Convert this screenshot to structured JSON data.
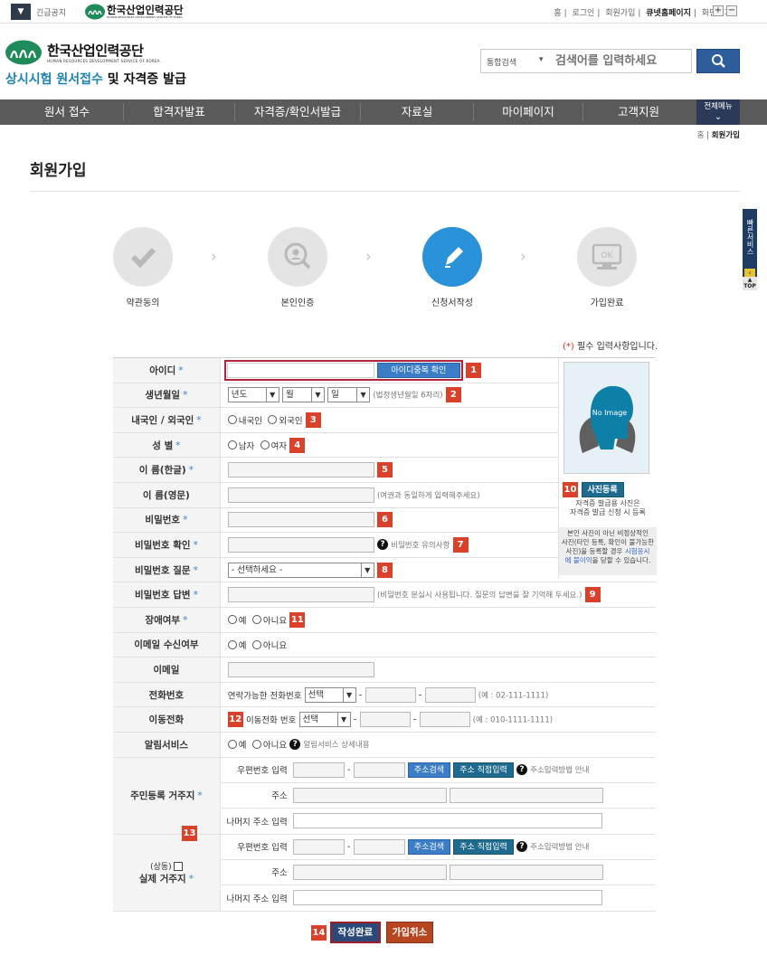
{
  "topbar": {
    "urgent": "긴급공지",
    "logo_ko": "한국산업인력공단",
    "logo_en": "HUMAN RESOURCES DEVELOPMENT SERVICE OF KOREA",
    "links": [
      "홈",
      "로그인",
      "회원가입",
      "큐넷홈페이지",
      "화면크기"
    ],
    "zoom_in": "+",
    "zoom_out": "−"
  },
  "header": {
    "logo_ko": "한국산업인력공단",
    "logo_en": "HUMAN RESOURCES DEVELOPMENT SERVICE OF KOREA",
    "subtitle_hl": "상시시험 원서접수",
    "subtitle_rest": " 및 자격증 발급",
    "search_scope": "통합검색",
    "search_placeholder": "검색어를 입력하세요"
  },
  "gnb": {
    "items": [
      "원서 접수",
      "합격자발표",
      "자격증/확인서발급",
      "자료실",
      "마이페이지",
      "고객지원"
    ],
    "all_menu": "전체메뉴"
  },
  "breadcrumb": {
    "home": "홈",
    "current": "회원가입"
  },
  "page_title": "회원가입",
  "quick": {
    "label": "빠른서비스",
    "top": "TOP"
  },
  "steps": [
    {
      "label": "약관동의",
      "state": "done"
    },
    {
      "label": "본인인증",
      "state": "done"
    },
    {
      "label": "신청서작성",
      "state": "active"
    },
    {
      "label": "가입완료",
      "state": "todo"
    }
  ],
  "required_note": {
    "mark": "(*)",
    "text": " 필수 입력사항입니다."
  },
  "form": {
    "id": {
      "label": "아이디",
      "button": "아이디중복 확인",
      "num": "1"
    },
    "birth": {
      "label": "생년월일",
      "year": "년도",
      "month": "월",
      "day": "일",
      "hint": "(법정생년월일 6자리)",
      "num": "2"
    },
    "nation": {
      "label": "내국인 / 외국인",
      "opt1": "내국인",
      "opt2": "외국인",
      "num": "3"
    },
    "gender": {
      "label": "성 별",
      "opt1": "남자",
      "opt2": "여자",
      "num": "4"
    },
    "name_ko": {
      "label": "이 름(한글)",
      "num": "5"
    },
    "name_en": {
      "label": "이 름(영문)",
      "hint": "(여권과 동일하게 입력해주세요)"
    },
    "password": {
      "label": "비밀번호",
      "num": "6"
    },
    "password_confirm": {
      "label": "비밀번호 확인",
      "hint": "비밀번호 유의사항",
      "num": "7"
    },
    "pw_question": {
      "label": "비밀번호 질문",
      "selected": "- 선택하세요 -",
      "num": "8"
    },
    "pw_answer": {
      "label": "비밀번호 답변",
      "hint": "(비밀번호 분실시 사용됩니다. 질문의 답변을 잘 기억해 두세요.)",
      "num": "9"
    },
    "disability": {
      "label": "장애여부",
      "opt1": "예",
      "opt2": "아니요",
      "num": "11"
    },
    "email_recv": {
      "label": "이메일 수신여부",
      "opt1": "예",
      "opt2": "아니요"
    },
    "email": {
      "label": "이메일"
    },
    "phone": {
      "label": "전화번호",
      "prefix": "연락가능한 전화번호",
      "selected": "선택",
      "example": "(예 : 02-111-1111)"
    },
    "mobile": {
      "label": "이동전화",
      "prefix": "이동전화 번호",
      "selected": "선택",
      "example": "(예 : 010-1111-1111)",
      "num": "12"
    },
    "notify": {
      "label": "알림서비스",
      "opt1": "예",
      "opt2": "아니요",
      "hint": "알림서비스 상세내용"
    },
    "reg_address": {
      "label": "주민등록 거주지",
      "zip_label": "우편번호 입력",
      "btn_search": "주소검색",
      "btn_direct": "주소 직접입력",
      "guide": "주소입력방법 안내",
      "addr_label": "주소",
      "rest_label": "나머지 주소 입력",
      "num": "13"
    },
    "real_address": {
      "same": "(상동)",
      "label": "실제 거주지",
      "zip_label": "우편번호 입력",
      "btn_search": "주소검색",
      "btn_direct": "주소 직접입력",
      "guide": "주소입력방법 안내",
      "addr_label": "주소",
      "rest_label": "나머지 주소 입력"
    }
  },
  "photo": {
    "placeholder": "No Image",
    "button": "사진등록",
    "num": "10",
    "caption1": "자격증 발급용 사진은",
    "caption2": "자격증 발급 신청 시 등록",
    "note1": "본인 사진이 아닌 비정상적인",
    "note2": "사진(타인 등록, 확인이 불가능한",
    "note3": "사진)을 등록할 경우 ",
    "note_link1": "시험응시",
    "note_link2": "에 불이익",
    "note4": "을 당할 수 있습니다."
  },
  "footer": {
    "num": "14",
    "submit": "작성완료",
    "cancel": "가입취소"
  }
}
